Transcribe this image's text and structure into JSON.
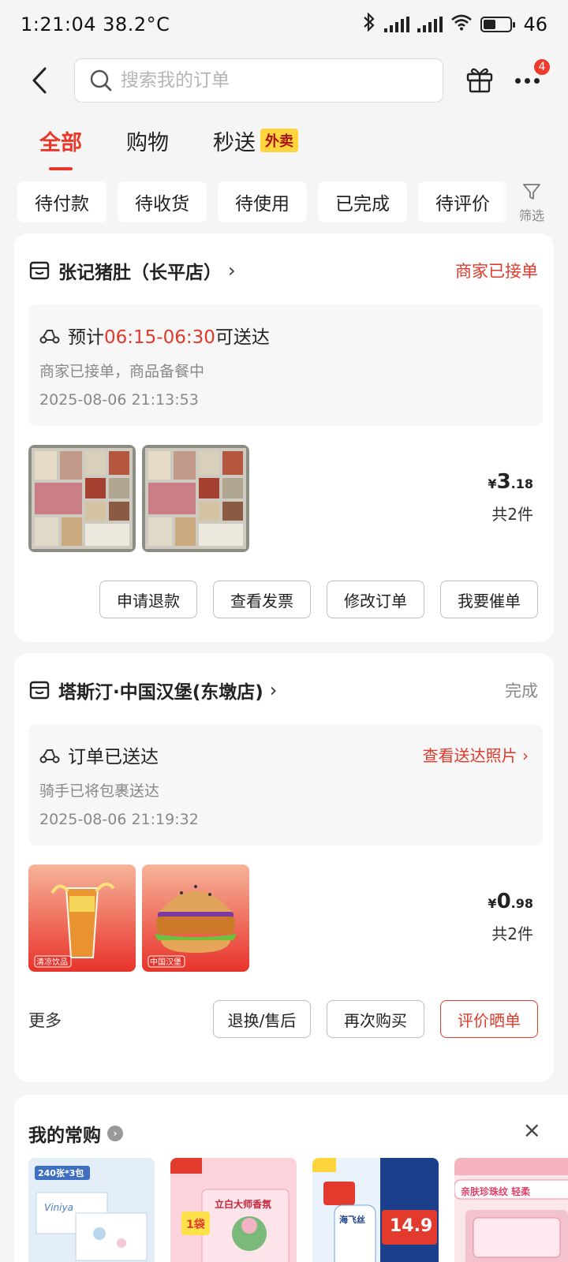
{
  "status_bar": {
    "time_temp": "1:21:04 38.2°C",
    "battery": "46"
  },
  "header": {
    "search_placeholder": "搜索我的订单",
    "notification_count": "4"
  },
  "tabs": [
    {
      "label": "全部"
    },
    {
      "label": "购物"
    },
    {
      "label": "秒送",
      "tag": "外卖"
    }
  ],
  "filters": [
    "待付款",
    "待收货",
    "待使用",
    "已完成",
    "待评价"
  ],
  "filter_button_label": "筛选",
  "orders": [
    {
      "shop": "张记猪肚（长平店）",
      "status": "商家已接单",
      "eta_prefix": "预计",
      "eta_time": "06:15-06:30",
      "eta_suffix": "可送达",
      "sub_status": "商家已接单，商品备餐中",
      "timestamp": "2025-08-06 21:13:53",
      "price_symbol": "¥",
      "price_int": "3",
      "price_dec": ".18",
      "count": "共2件",
      "actions": [
        "申请退款",
        "查看发票",
        "修改订单",
        "我要催单"
      ]
    },
    {
      "shop": "塔斯汀·中国汉堡(东墩店)",
      "status": "完成",
      "delivered": "订单已送达",
      "photo_link": "查看送达照片",
      "sub_status": "骑手已将包裹送达",
      "timestamp": "2025-08-06 21:19:32",
      "item_tags": [
        "清凉饮品",
        "中国汉堡"
      ],
      "price_symbol": "¥",
      "price_int": "0",
      "price_dec": ".98",
      "count": "共2件",
      "more": "更多",
      "actions": [
        "退换/售后",
        "再次购买",
        "评价晒单"
      ]
    }
  ],
  "favorites": {
    "title": "我的常购",
    "items": [
      {
        "name": "Viniya",
        "promo": "240张*3包"
      },
      {
        "name": "立白大师香氛",
        "promo": "1袋"
      },
      {
        "name": "海飞丝",
        "promo": "14.9"
      },
      {
        "name": "亲肤珍珠纹",
        "promo": "亲肤珍珠纹 轻柔"
      }
    ]
  },
  "colors": {
    "accent": "#e03a2c",
    "tag_yellow": "#ffd43c",
    "background": "#f5f5f5"
  }
}
